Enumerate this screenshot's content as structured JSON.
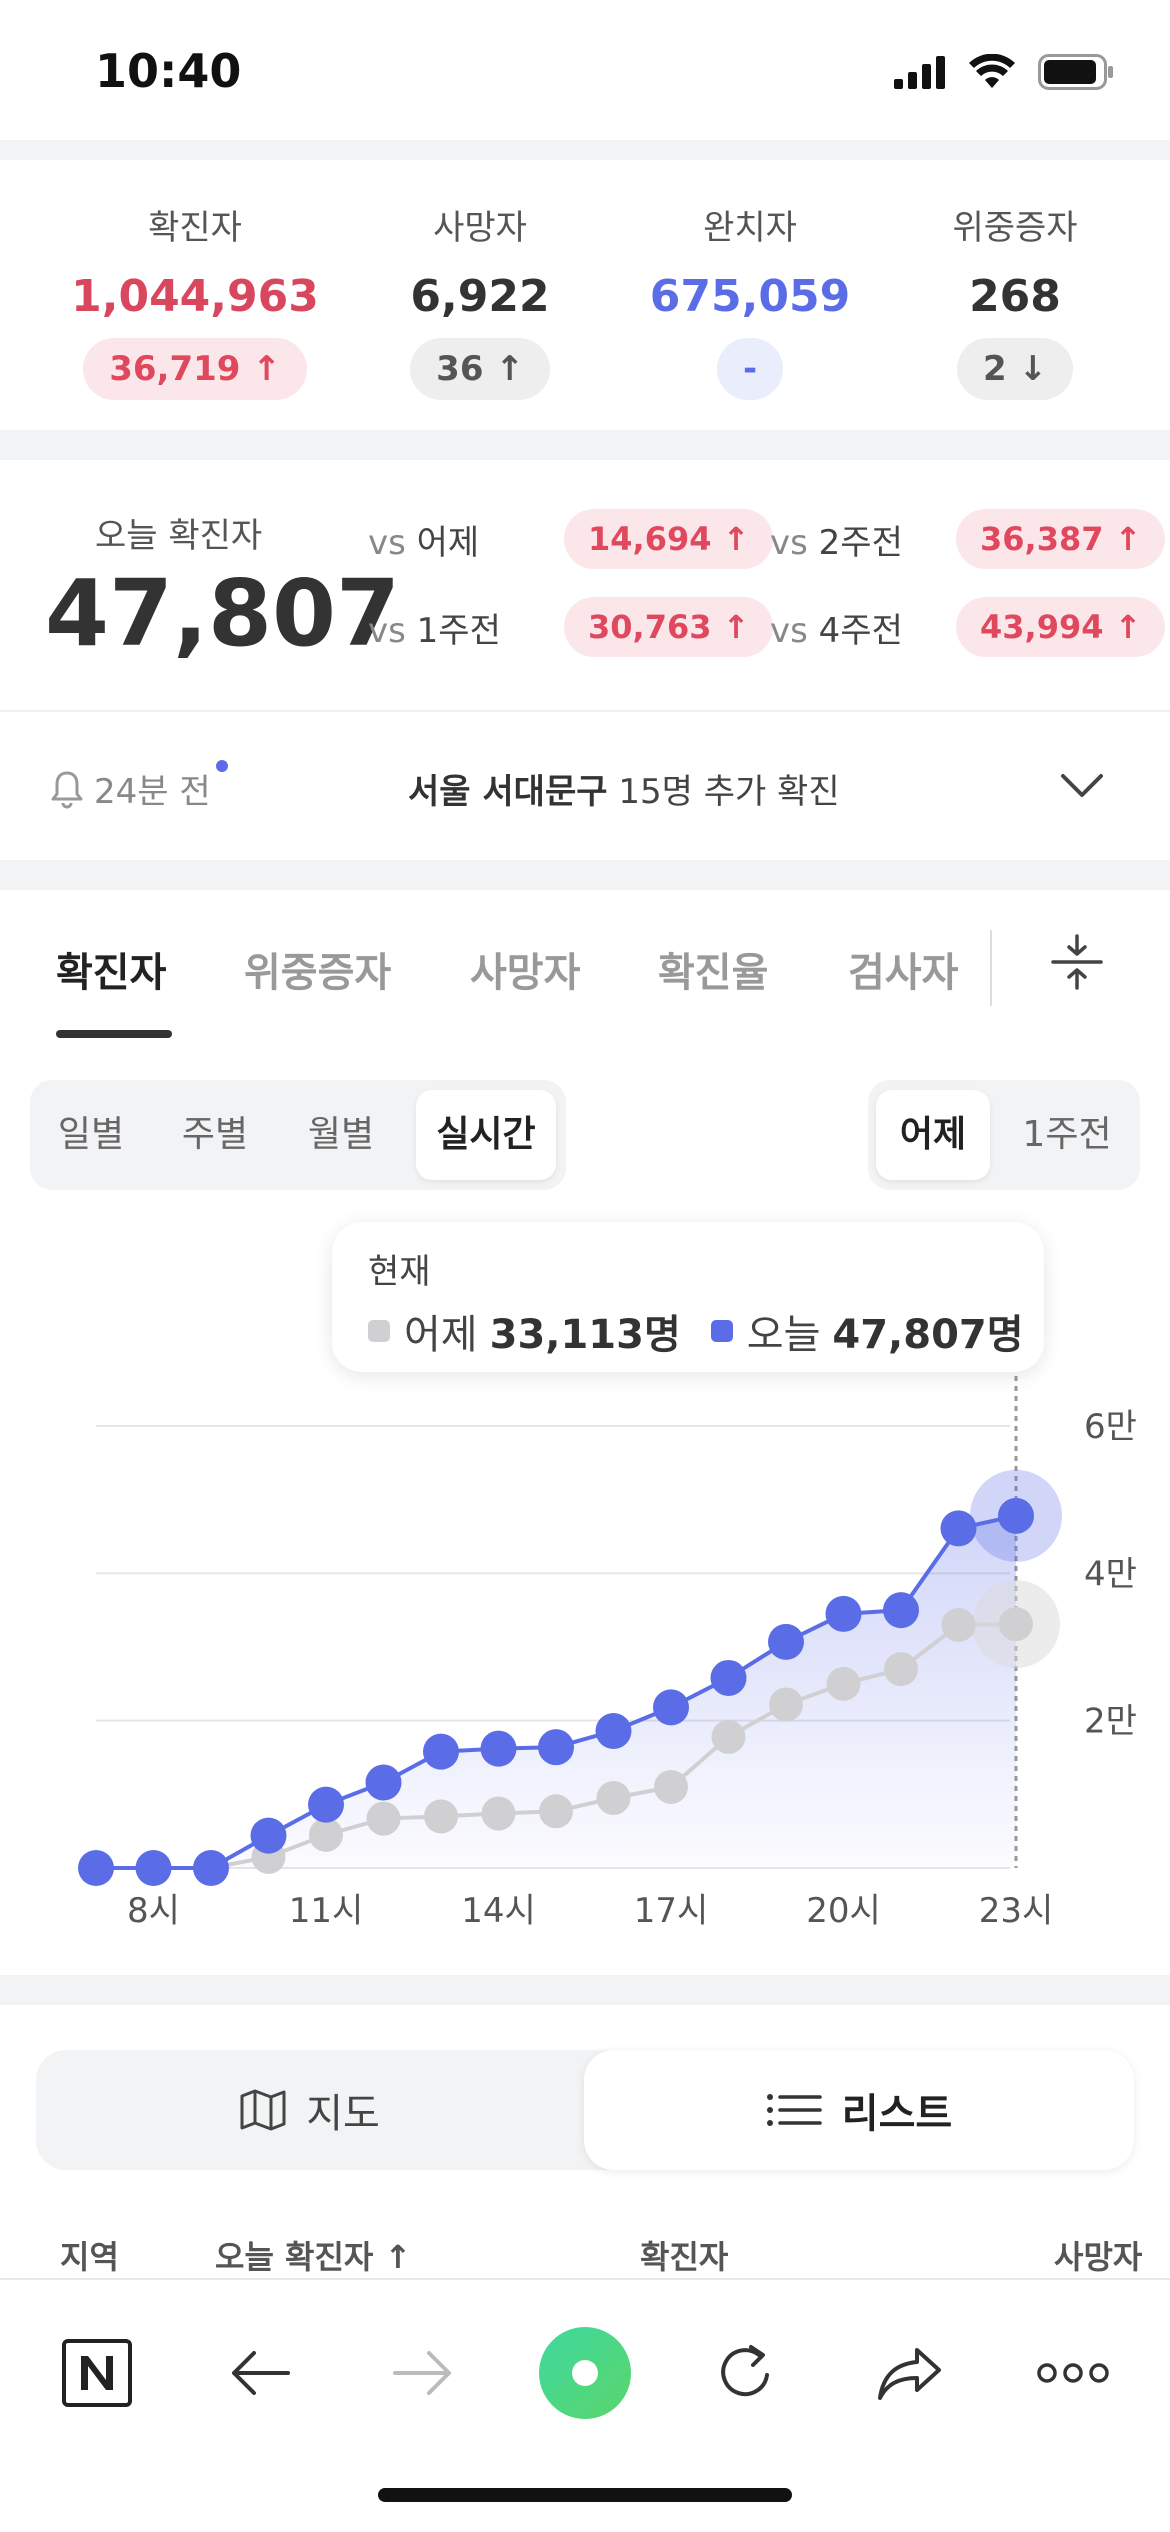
{
  "status_bar": {
    "time": "10:40"
  },
  "summary": [
    {
      "label": "확진자",
      "value": "1,044,963",
      "change": "36,719 ↑",
      "value_color": "#d9475f",
      "badge_bg": "#fbe7ea",
      "badge_color": "#e0485e"
    },
    {
      "label": "사망자",
      "value": "6,922",
      "change": "36 ↑",
      "value_color": "#333333",
      "badge_bg": "#eeeeef",
      "badge_color": "#555555"
    },
    {
      "label": "완치자",
      "value": "675,059",
      "change": "-",
      "value_color": "#5b6de6",
      "badge_bg": "#eaedfc",
      "badge_color": "#5b6de6"
    },
    {
      "label": "위중증자",
      "value": "268",
      "change": "2 ↓",
      "value_color": "#333333",
      "badge_bg": "#eeeeef",
      "badge_color": "#555555"
    }
  ],
  "today": {
    "label": "오늘 확진자",
    "value": "47,807",
    "comparisons": [
      {
        "vs": "vs",
        "label": "어제",
        "value": "14,694 ↑"
      },
      {
        "vs": "vs",
        "label": "2주전",
        "value": "36,387 ↑"
      },
      {
        "vs": "vs",
        "label": "1주전",
        "value": "30,763 ↑"
      },
      {
        "vs": "vs",
        "label": "4주전",
        "value": "43,994 ↑"
      }
    ]
  },
  "notice": {
    "time": "24분 전",
    "region": "서울 서대문구",
    "text": "15명 추가 확진"
  },
  "tabs": [
    "확진자",
    "위중증자",
    "사망자",
    "확진율",
    "검사자"
  ],
  "period_tabs": [
    "일별",
    "주별",
    "월별",
    "실시간"
  ],
  "compare_tabs": [
    "어제",
    "1주전"
  ],
  "tooltip": {
    "title": "현재",
    "yesterday_label": "어제",
    "yesterday_value": "33,113명",
    "today_label": "오늘",
    "today_value": "47,807명"
  },
  "chart_data": {
    "type": "line",
    "x": [
      "7시",
      "8시",
      "9시",
      "10시",
      "11시",
      "12시",
      "13시",
      "14시",
      "15시",
      "16시",
      "17시",
      "18시",
      "19시",
      "20시",
      "21시",
      "22시",
      "23시"
    ],
    "x_tick_labels": [
      "8시",
      "11시",
      "14시",
      "17시",
      "20시",
      "23시"
    ],
    "y_tick_labels": [
      "2만",
      "4만",
      "6만"
    ],
    "ylim": [
      0,
      60000
    ],
    "series": [
      {
        "name": "오늘",
        "color": "#5b6de6",
        "values": [
          0,
          0,
          0,
          4400,
          8600,
          11600,
          15800,
          16200,
          16400,
          18600,
          21800,
          25800,
          30700,
          34500,
          35000,
          46100,
          47807
        ]
      },
      {
        "name": "어제",
        "color": "#d0d0d3",
        "values": [
          0,
          0,
          0,
          1500,
          4500,
          6700,
          7000,
          7400,
          7700,
          9500,
          11000,
          17800,
          22200,
          25000,
          27000,
          33000,
          33113
        ]
      }
    ],
    "grid": true
  },
  "view_toggle": {
    "map_label": "지도",
    "list_label": "리스트"
  },
  "list_header": {
    "region": "지역",
    "today": "오늘 확진자 ↑",
    "confirmed": "확진자",
    "deaths": "사망자"
  },
  "icons": [
    "bell-icon",
    "chevron-down-icon",
    "settings-sliders-icon",
    "map-icon",
    "list-icon",
    "naver-n-icon",
    "back-arrow-icon",
    "forward-arrow-icon",
    "green-dot-icon",
    "reload-icon",
    "share-icon",
    "more-icon"
  ]
}
